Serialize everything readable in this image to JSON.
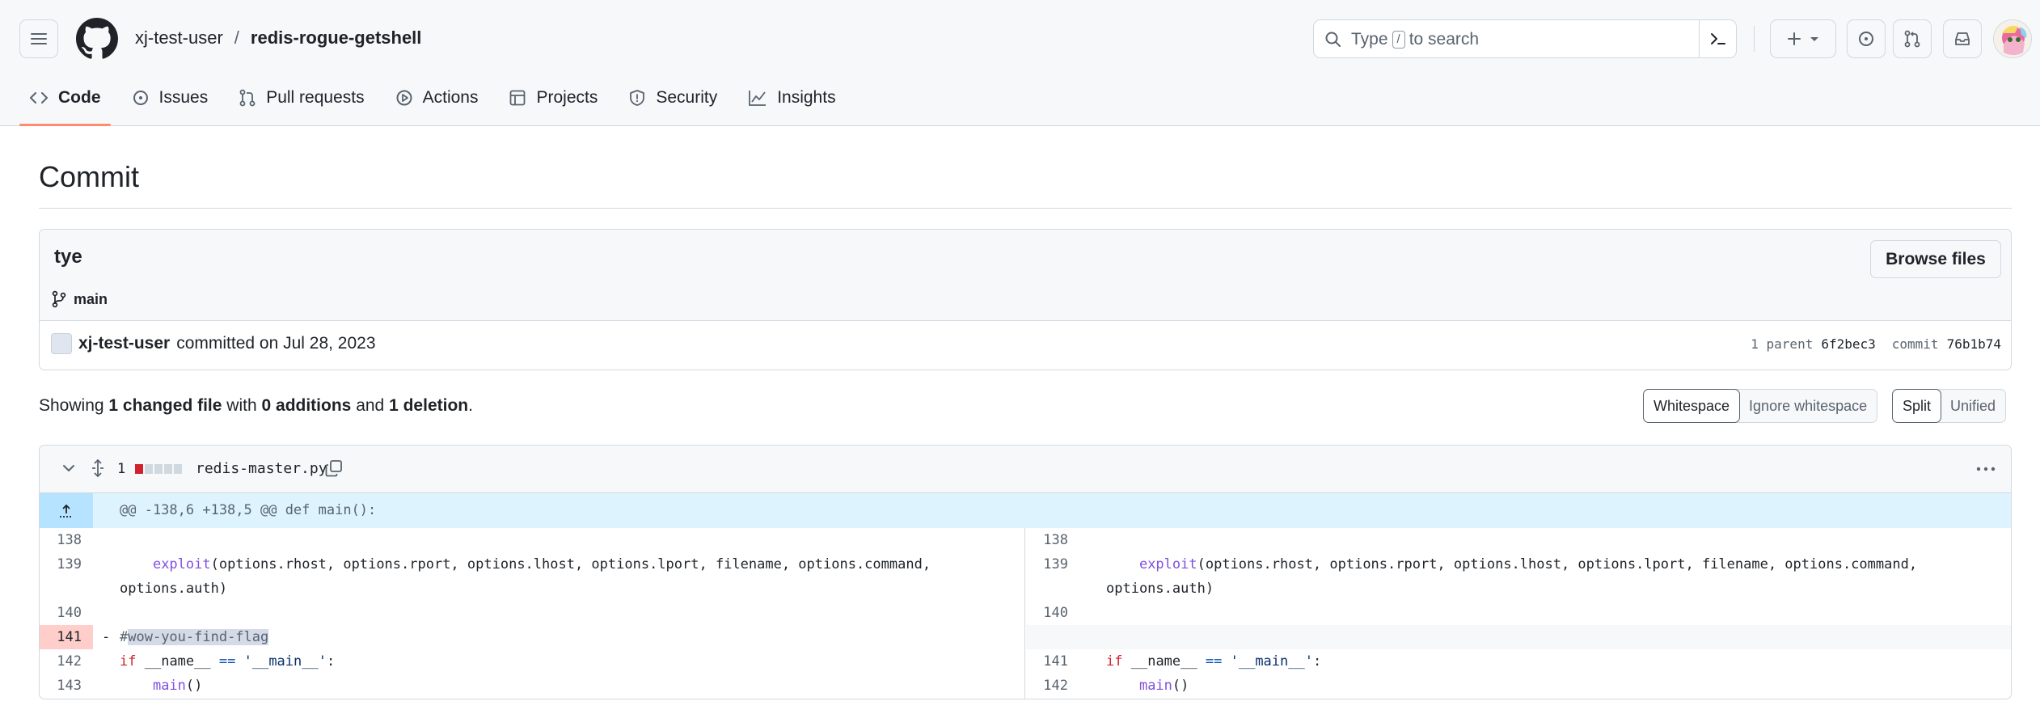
{
  "header": {
    "owner": "xj-test-user",
    "separator": "/",
    "repo": "redis-rogue-getshell",
    "search_prefix": "Type",
    "search_key": "/",
    "search_suffix": "to search"
  },
  "tabs": [
    {
      "label": "Code",
      "icon": "code-icon",
      "active": true
    },
    {
      "label": "Issues",
      "icon": "issue-icon"
    },
    {
      "label": "Pull requests",
      "icon": "pull-request-icon"
    },
    {
      "label": "Actions",
      "icon": "play-icon"
    },
    {
      "label": "Projects",
      "icon": "table-icon"
    },
    {
      "label": "Security",
      "icon": "shield-icon"
    },
    {
      "label": "Insights",
      "icon": "graph-icon"
    }
  ],
  "page": {
    "title": "Commit"
  },
  "commit": {
    "message": "tye",
    "branch": "main",
    "browse_label": "Browse files",
    "author": "xj-test-user",
    "committed_text": "committed on Jul 28, 2023",
    "parent_label": "1 parent",
    "parent_sha": "6f2bec3",
    "commit_label": "commit",
    "commit_sha": "76b1b74"
  },
  "summary": {
    "showing": "Showing",
    "changed": "1 changed file",
    "with": "with",
    "additions": "0 additions",
    "and": "and",
    "deletions": "1 deletion",
    "end": "."
  },
  "view_options": {
    "whitespace": "Whitespace",
    "ignore_whitespace": "Ignore whitespace",
    "split": "Split",
    "unified": "Unified"
  },
  "diff": {
    "change_count": "1",
    "file_name": "redis-master.py",
    "hunk_header": "@@ -138,6 +138,5 @@ def main():",
    "left": {
      "ln138": "138",
      "ln139": "139",
      "ln140": "140",
      "ln141": "141",
      "ln142": "142",
      "ln143": "143",
      "call_line_a": "options.rhost, options.rport, options.lhost, options.lport, filename, options.command,",
      "call_line_b": "options.auth)",
      "deleted_hash": "#",
      "deleted_rest": "wow-you-find-flag",
      "del_sign": "-"
    },
    "right": {
      "ln138": "138",
      "ln139": "139",
      "ln140": "140",
      "ln141": "141",
      "ln142": "142",
      "call_line_a": "options.rhost, options.rport, options.lhost, options.lport, filename, options.command,",
      "call_line_b": "options.auth)"
    },
    "tokens": {
      "exploit": "exploit",
      "paren": "(",
      "if": "if",
      "name_var": "__name__",
      "eq": "==",
      "main_str": "'__main__'",
      "colon": ":",
      "main_call": "main",
      "call_parens": "()"
    }
  }
}
